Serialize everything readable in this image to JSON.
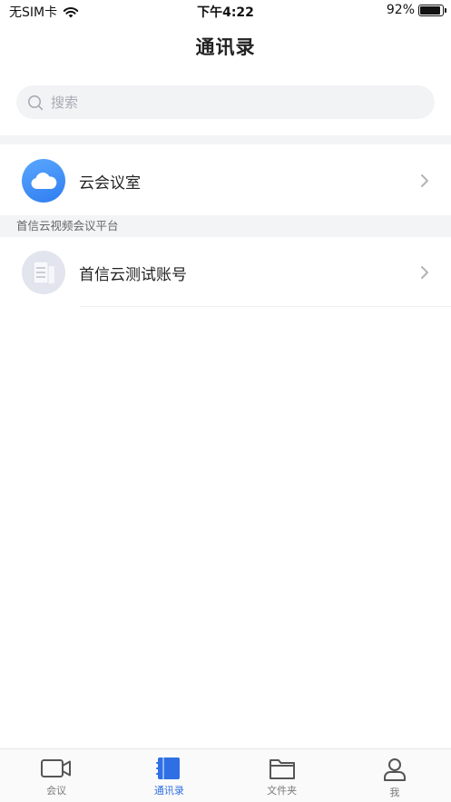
{
  "status_bar": {
    "carrier": "无SIM卡",
    "time": "下午4:22",
    "battery": "92%",
    "battery_level": 0.92
  },
  "header": {
    "title": "通讯录"
  },
  "search": {
    "placeholder": "搜索",
    "icon": "search-icon"
  },
  "contacts": {
    "cloud_meeting": {
      "label": "云会议室",
      "icon": "cloud-icon"
    },
    "section_title": "首信云视频会议平台",
    "account": {
      "label": "首信云测试账号",
      "icon": "document-icon"
    }
  },
  "tab_bar": {
    "active_color": "#2f6fe4",
    "items": [
      {
        "label": "会议",
        "icon": "video-camera-icon",
        "active": false
      },
      {
        "label": "通讯录",
        "icon": "contacts-book-icon",
        "active": true
      },
      {
        "label": "文件夹",
        "icon": "folder-icon",
        "active": false
      },
      {
        "label": "我",
        "icon": "person-icon",
        "active": false
      }
    ]
  }
}
